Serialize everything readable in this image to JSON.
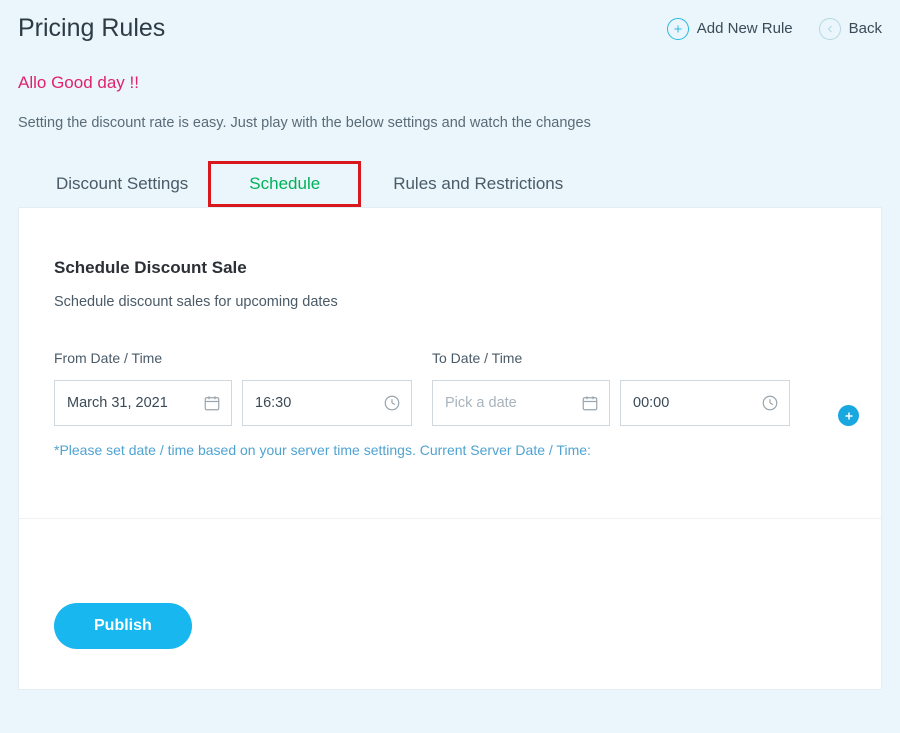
{
  "header": {
    "title": "Pricing Rules",
    "add_rule_label": "Add New Rule",
    "back_label": "Back"
  },
  "greeting": "Allo Good day !!",
  "subtitle": "Setting the discount rate is easy. Just play with the below settings and watch the changes",
  "tabs": {
    "discount": "Discount Settings",
    "schedule": "Schedule",
    "rules": "Rules and Restrictions",
    "active": "schedule"
  },
  "schedule": {
    "title": "Schedule Discount Sale",
    "desc": "Schedule discount sales for upcoming dates",
    "from_label": "From Date / Time",
    "to_label": "To Date / Time",
    "from_date_value": "March 31, 2021",
    "from_time_value": "16:30",
    "to_date_placeholder": "Pick a date",
    "to_time_value": "00:00",
    "note": "*Please set date / time based on your server time settings. Current Server Date / Time:"
  },
  "footer": {
    "publish_label": "Publish"
  }
}
